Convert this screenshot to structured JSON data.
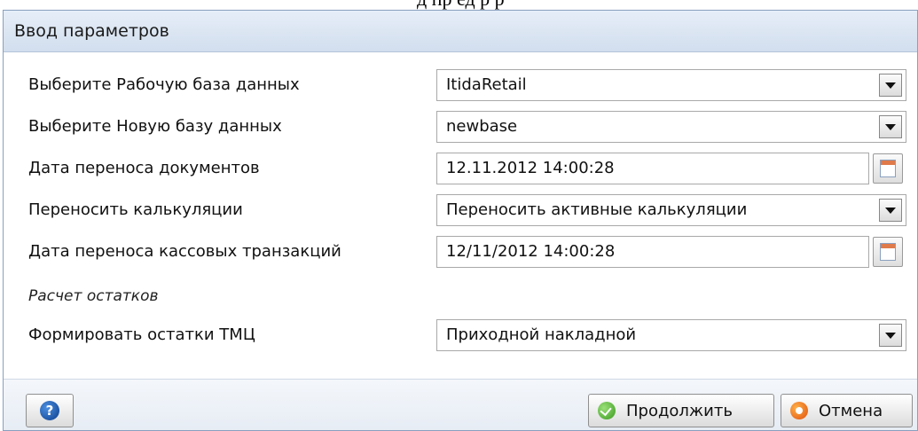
{
  "background_text": "д    пр ед   р    р",
  "dialog": {
    "title": "Ввод параметров",
    "fields": [
      {
        "label": "Выберите Рабочую база данных",
        "value": "ItidaRetail",
        "type": "select"
      },
      {
        "label": "Выберите Новую базу данных",
        "value": "newbase",
        "type": "select"
      },
      {
        "label": "Дата переноса документов",
        "value": "12.11.2012 14:00:28",
        "type": "date"
      },
      {
        "label": "Переносить калькуляции",
        "value": "Переносить активные калькуляции",
        "type": "select"
      },
      {
        "label": "Дата переноса кассовых транзакций",
        "value": "12/11/2012 14:00:28",
        "type": "date"
      }
    ],
    "section_title": "Расчет остатков",
    "remainder_field": {
      "label": "Формировать остатки ТМЦ",
      "value": "Приходной накладной",
      "type": "select"
    }
  },
  "footer": {
    "help_label": "?",
    "continue_label": "Продолжить",
    "cancel_label": "Отмена"
  },
  "icons": {
    "help": "help-icon",
    "continue": "check-icon",
    "cancel": "cancel-icon",
    "calendar": "calendar-icon",
    "dropdown": "chevron-down-icon"
  }
}
